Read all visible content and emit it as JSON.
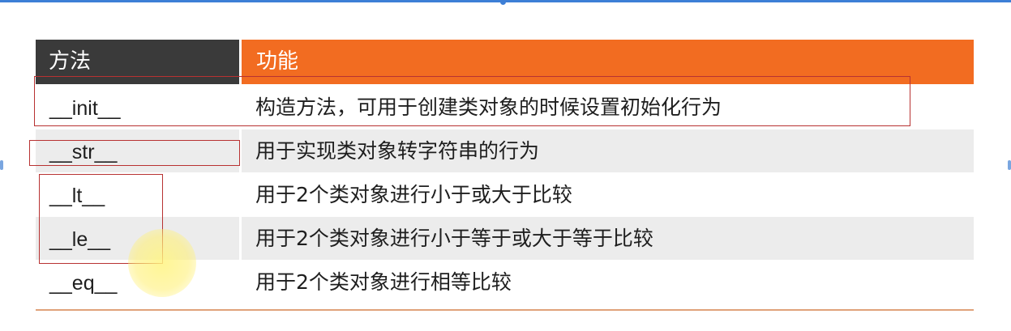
{
  "table": {
    "headers": [
      "方法",
      "功能"
    ],
    "rows": [
      {
        "method": "__init__",
        "description": "构造方法，可用于创建类对象的时候设置初始化行为"
      },
      {
        "method": "__str__",
        "description": "用于实现类对象转字符串的行为"
      },
      {
        "method": "__lt__",
        "description": "用于2个类对象进行小于或大于比较"
      },
      {
        "method": "__le__",
        "description": "用于2个类对象进行小于等于或大于等于比较"
      },
      {
        "method": "__eq__",
        "description": "用于2个类对象进行相等比较"
      }
    ]
  },
  "colors": {
    "header_dark": "#3a3a3a",
    "header_accent": "#f26c21",
    "row_shade": "#ececec",
    "highlight_box": "#b83232",
    "top_bar": "#3d7fd6"
  }
}
